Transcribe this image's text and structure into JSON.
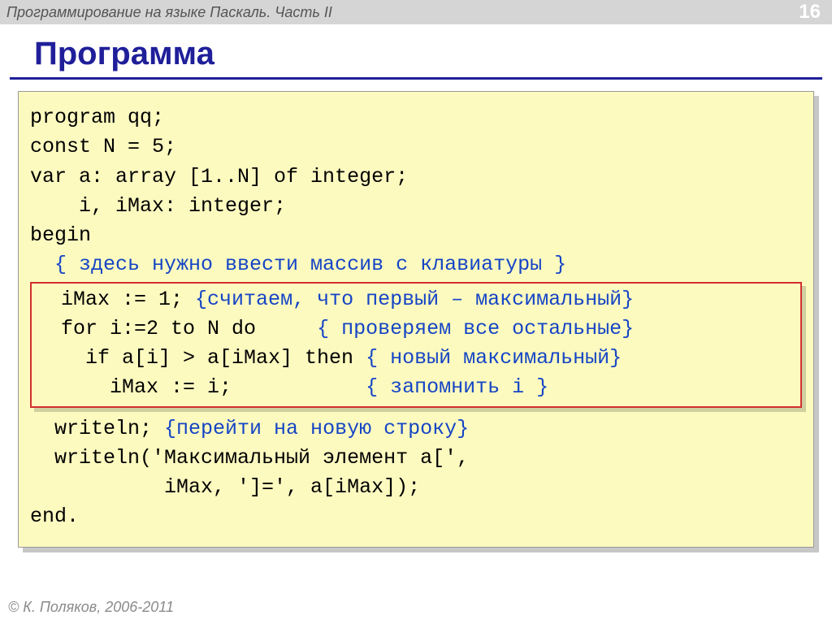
{
  "header": {
    "course_title": "Программирование на языке Паскаль. Часть II",
    "page_number": "16"
  },
  "title": "Программа",
  "code": {
    "l1": "program qq;",
    "l2": "const N = 5;",
    "l3": "var a: array [1..N] of integer;",
    "l4": "    i, iMax: integer;",
    "l5": "begin",
    "l6_cmt": "  { здесь нужно ввести массив с клавиатуры }",
    "box": {
      "b1a": "  iMax := 1; ",
      "b1b": "{считаем, что первый – максимальный}",
      "b2a": "  for i:=2 to N do     ",
      "b2b": "{ проверяем все остальные}",
      "b3a": "    if a[i] > a[iMax] then ",
      "b3b": "{ новый максимальный}",
      "b4a": "      iMax := i;           ",
      "b4b": "{ запомнить i }"
    },
    "l7a": "  writeln; ",
    "l7b": "{перейти на новую строку}",
    "l8": "  writeln('Максимальный элемент a[',",
    "l9": "           iMax, ']=', a[iMax]);",
    "l10": "end."
  },
  "footer": {
    "copyright": "© К. Поляков, 2006-2011"
  }
}
